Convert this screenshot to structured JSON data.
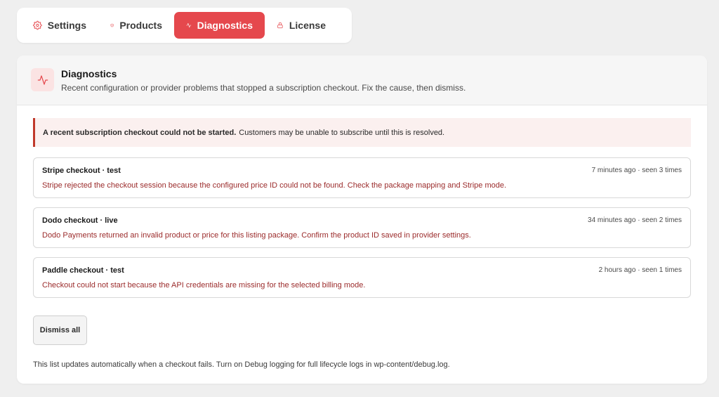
{
  "tabs": [
    {
      "label": "Settings",
      "icon": "gear-icon",
      "active": false
    },
    {
      "label": "Products",
      "icon": "box-icon",
      "active": false
    },
    {
      "label": "Diagnostics",
      "icon": "activity-icon",
      "active": true
    },
    {
      "label": "License",
      "icon": "lock-icon",
      "active": false
    }
  ],
  "colors": {
    "accent": "#e5484d",
    "error_text": "#9b2b2b",
    "alert_bg": "#fbf0ef",
    "alert_border": "#c0392b"
  },
  "panel": {
    "icon": "activity-icon",
    "title": "Diagnostics",
    "subtitle": "Recent configuration or provider problems that stopped a subscription checkout. Fix the cause, then dismiss."
  },
  "alert": {
    "bold": "A recent subscription checkout could not be started.",
    "text": "Customers may be unable to subscribe until this is resolved."
  },
  "issues": [
    {
      "title": "Stripe checkout · test",
      "meta": "7 minutes ago · seen 3 times",
      "message": "Stripe rejected the checkout session because the configured price ID could not be found. Check the package mapping and Stripe mode."
    },
    {
      "title": "Dodo checkout · live",
      "meta": "34 minutes ago · seen 2 times",
      "message": "Dodo Payments returned an invalid product or price for this listing package. Confirm the product ID saved in provider settings."
    },
    {
      "title": "Paddle checkout · test",
      "meta": "2 hours ago · seen 1 times",
      "message": "Checkout could not start because the API credentials are missing for the selected billing mode."
    }
  ],
  "dismiss_label": "Dismiss all",
  "footnote": "This list updates automatically when a checkout fails. Turn on Debug logging for full lifecycle logs in wp-content/debug.log."
}
